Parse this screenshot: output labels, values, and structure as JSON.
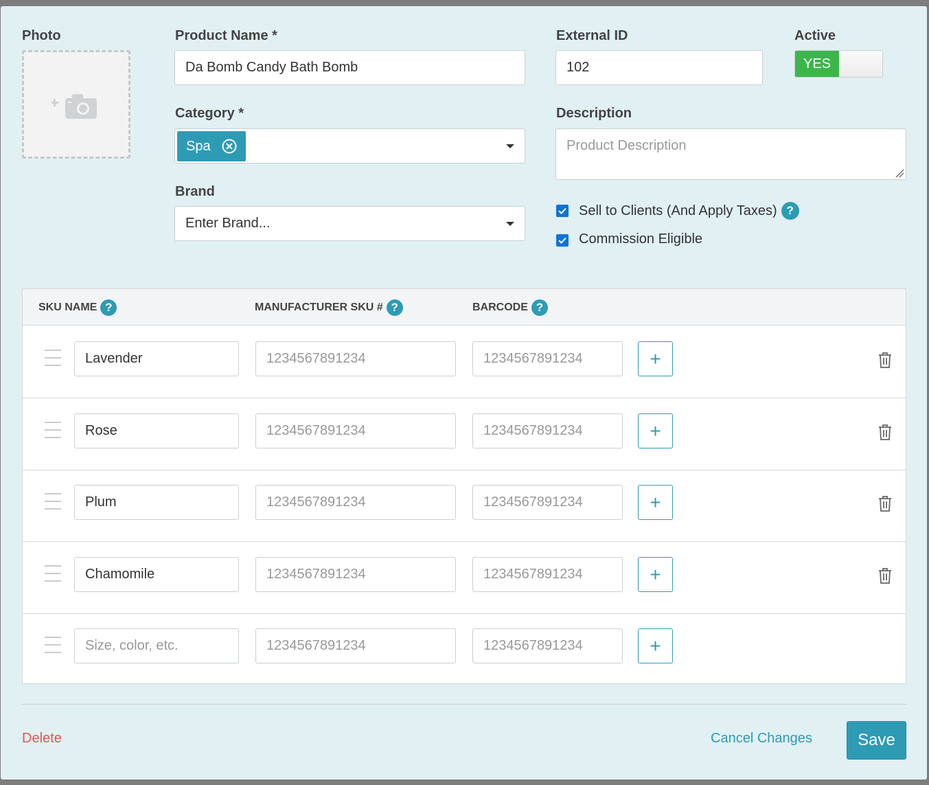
{
  "photo": {
    "label": "Photo"
  },
  "product_name": {
    "label": "Product Name *",
    "value": "Da Bomb Candy Bath Bomb"
  },
  "external_id": {
    "label": "External ID",
    "value": "102"
  },
  "active": {
    "label": "Active",
    "state": "YES"
  },
  "category": {
    "label": "Category *",
    "tag": "Spa"
  },
  "description": {
    "label": "Description",
    "placeholder": "Product Description"
  },
  "brand": {
    "label": "Brand",
    "placeholder": "Enter Brand..."
  },
  "options": {
    "sell_to_clients": {
      "label": "Sell to Clients (And Apply Taxes)",
      "checked": true
    },
    "commission_eligible": {
      "label": "Commission Eligible",
      "checked": true
    }
  },
  "sku_table": {
    "headers": {
      "sku_name": "SKU NAME",
      "manufacturer_sku": "MANUFACTURER SKU #",
      "barcode": "BARCODE"
    },
    "help_glyph": "?",
    "add_glyph": "+",
    "rows": [
      {
        "name": "Lavender",
        "manufacturer_sku_placeholder": "1234567891234",
        "barcode_placeholder": "1234567891234"
      },
      {
        "name": "Rose",
        "manufacturer_sku_placeholder": "1234567891234",
        "barcode_placeholder": "1234567891234"
      },
      {
        "name": "Plum",
        "manufacturer_sku_placeholder": "1234567891234",
        "barcode_placeholder": "1234567891234"
      },
      {
        "name": "Chamomile",
        "manufacturer_sku_placeholder": "1234567891234",
        "barcode_placeholder": "1234567891234"
      }
    ],
    "new_row": {
      "name_placeholder": "Size, color, etc.",
      "manufacturer_sku_placeholder": "1234567891234",
      "barcode_placeholder": "1234567891234"
    }
  },
  "footer": {
    "delete": "Delete",
    "cancel": "Cancel Changes",
    "save": "Save"
  },
  "colors": {
    "accent": "#2e9bb5",
    "toggle_on": "#3cb64b",
    "delete": "#e2574c",
    "background": "#e1f0f3"
  }
}
